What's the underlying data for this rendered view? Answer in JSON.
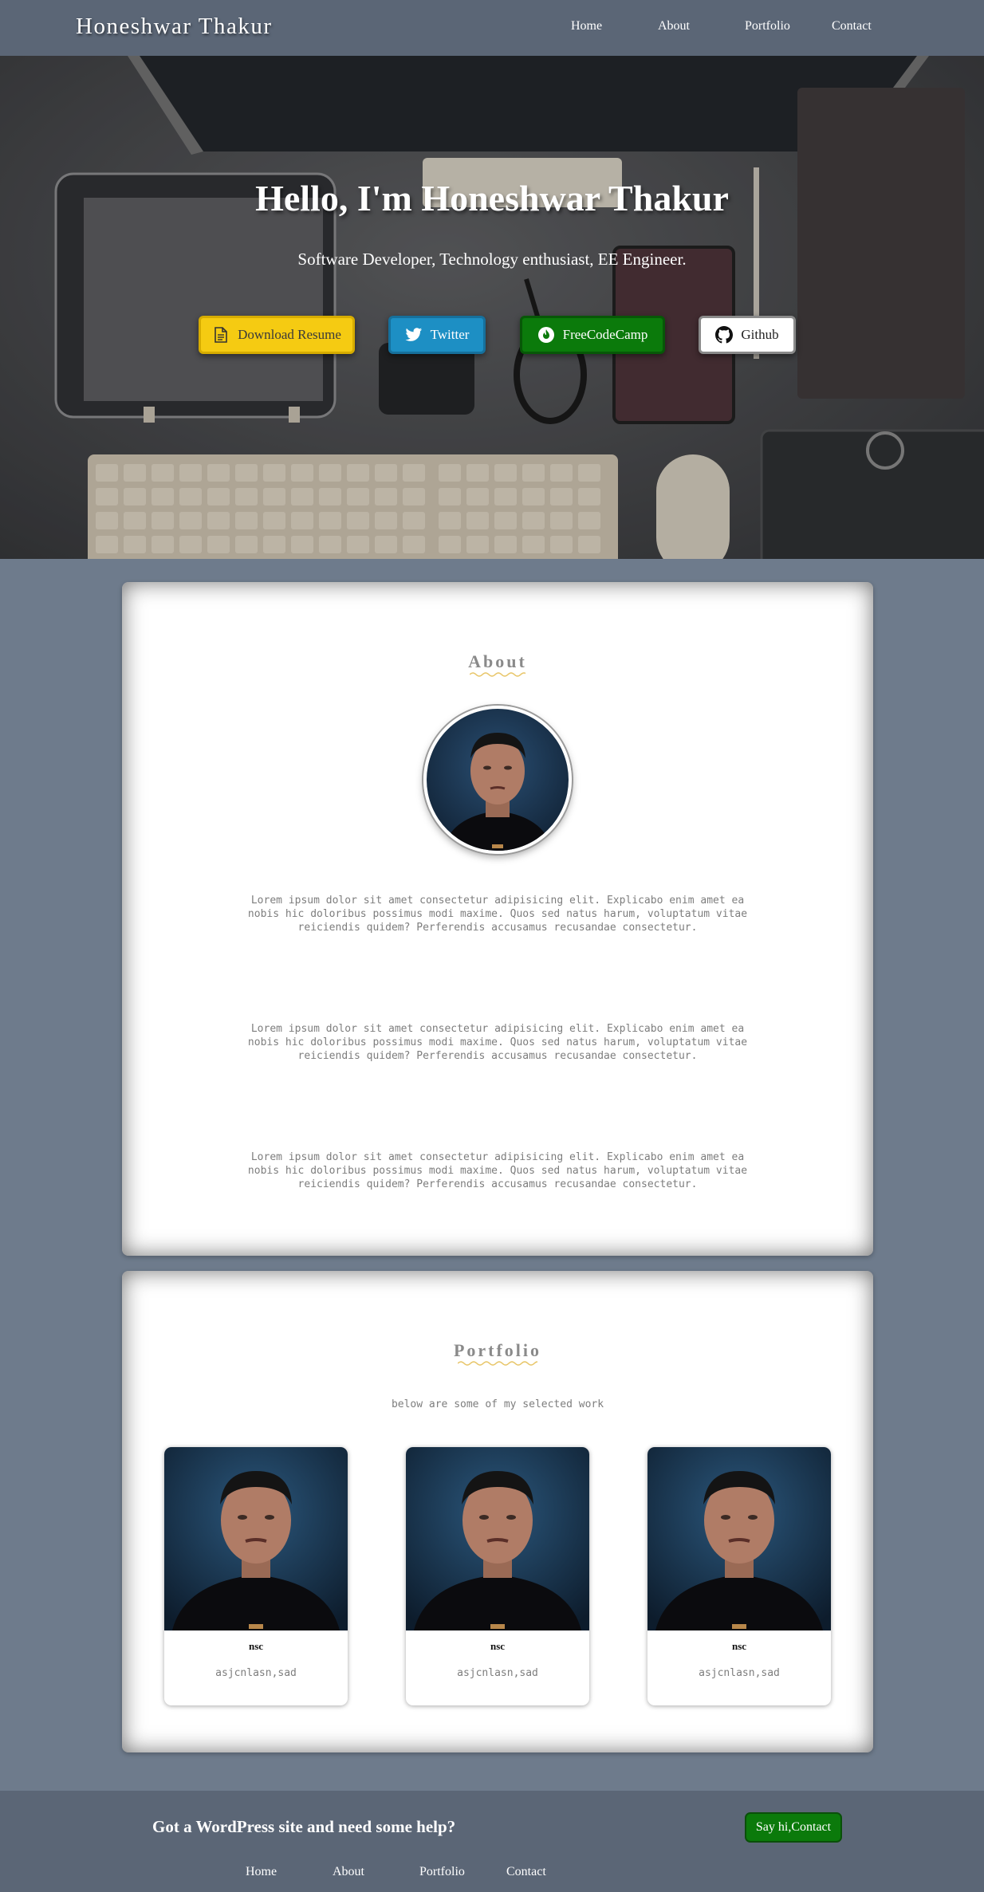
{
  "nav": {
    "brand": "Honeshwar Thakur",
    "links": [
      "Home",
      "About",
      "Portfolio",
      "Contact"
    ]
  },
  "hero": {
    "title": "Hello, I'm Honeshwar Thakur",
    "subtitle": "Software Developer, Technology enthusiast, EE Engineer.",
    "buttons": [
      {
        "label": "Download Resume",
        "icon": "document-icon",
        "color": "#f5cb12"
      },
      {
        "label": "Twitter",
        "icon": "twitter-icon",
        "color": "#1d8fc4"
      },
      {
        "label": "FreeCodeCamp",
        "icon": "freecodecamp-icon",
        "color": "#0b7a0b"
      },
      {
        "label": "Github",
        "icon": "github-icon",
        "color": "#ffffff"
      }
    ]
  },
  "about": {
    "title": "About",
    "paragraphs": [
      "Lorem ipsum dolor sit amet consectetur adipisicing elit. Explicabo enim amet ea nobis hic doloribus possimus modi maxime. Quos sed natus harum, voluptatum vitae reiciendis quidem? Perferendis accusamus recusandae consectetur.",
      "Lorem ipsum dolor sit amet consectetur adipisicing elit. Explicabo enim amet ea nobis hic doloribus possimus modi maxime. Quos sed natus harum, voluptatum vitae reiciendis quidem? Perferendis accusamus recusandae consectetur.",
      "Lorem ipsum dolor sit amet consectetur adipisicing elit. Explicabo enim amet ea nobis hic doloribus possimus modi maxime. Quos sed natus harum, voluptatum vitae reiciendis quidem? Perferendis accusamus recusandae consectetur."
    ]
  },
  "portfolio": {
    "title": "Portfolio",
    "subtitle": "below are some of my selected work",
    "items": [
      {
        "title": "nsc",
        "description": "asjcnlasn,sad"
      },
      {
        "title": "nsc",
        "description": "asjcnlasn,sad"
      },
      {
        "title": "nsc",
        "description": "asjcnlasn,sad"
      }
    ]
  },
  "footer": {
    "heading": "Got a WordPress site and need some help?",
    "button": "Say hi,Contact",
    "links": [
      "Home",
      "About",
      "Portfolio",
      "Contact"
    ]
  },
  "colors": {
    "nav_bg": "#5b6676",
    "page_bg": "#6e7b8c",
    "accent_yellow": "#f5cb12",
    "accent_blue": "#1d8fc4",
    "accent_green": "#0b7a0b",
    "squiggle": "#e8c66a"
  }
}
